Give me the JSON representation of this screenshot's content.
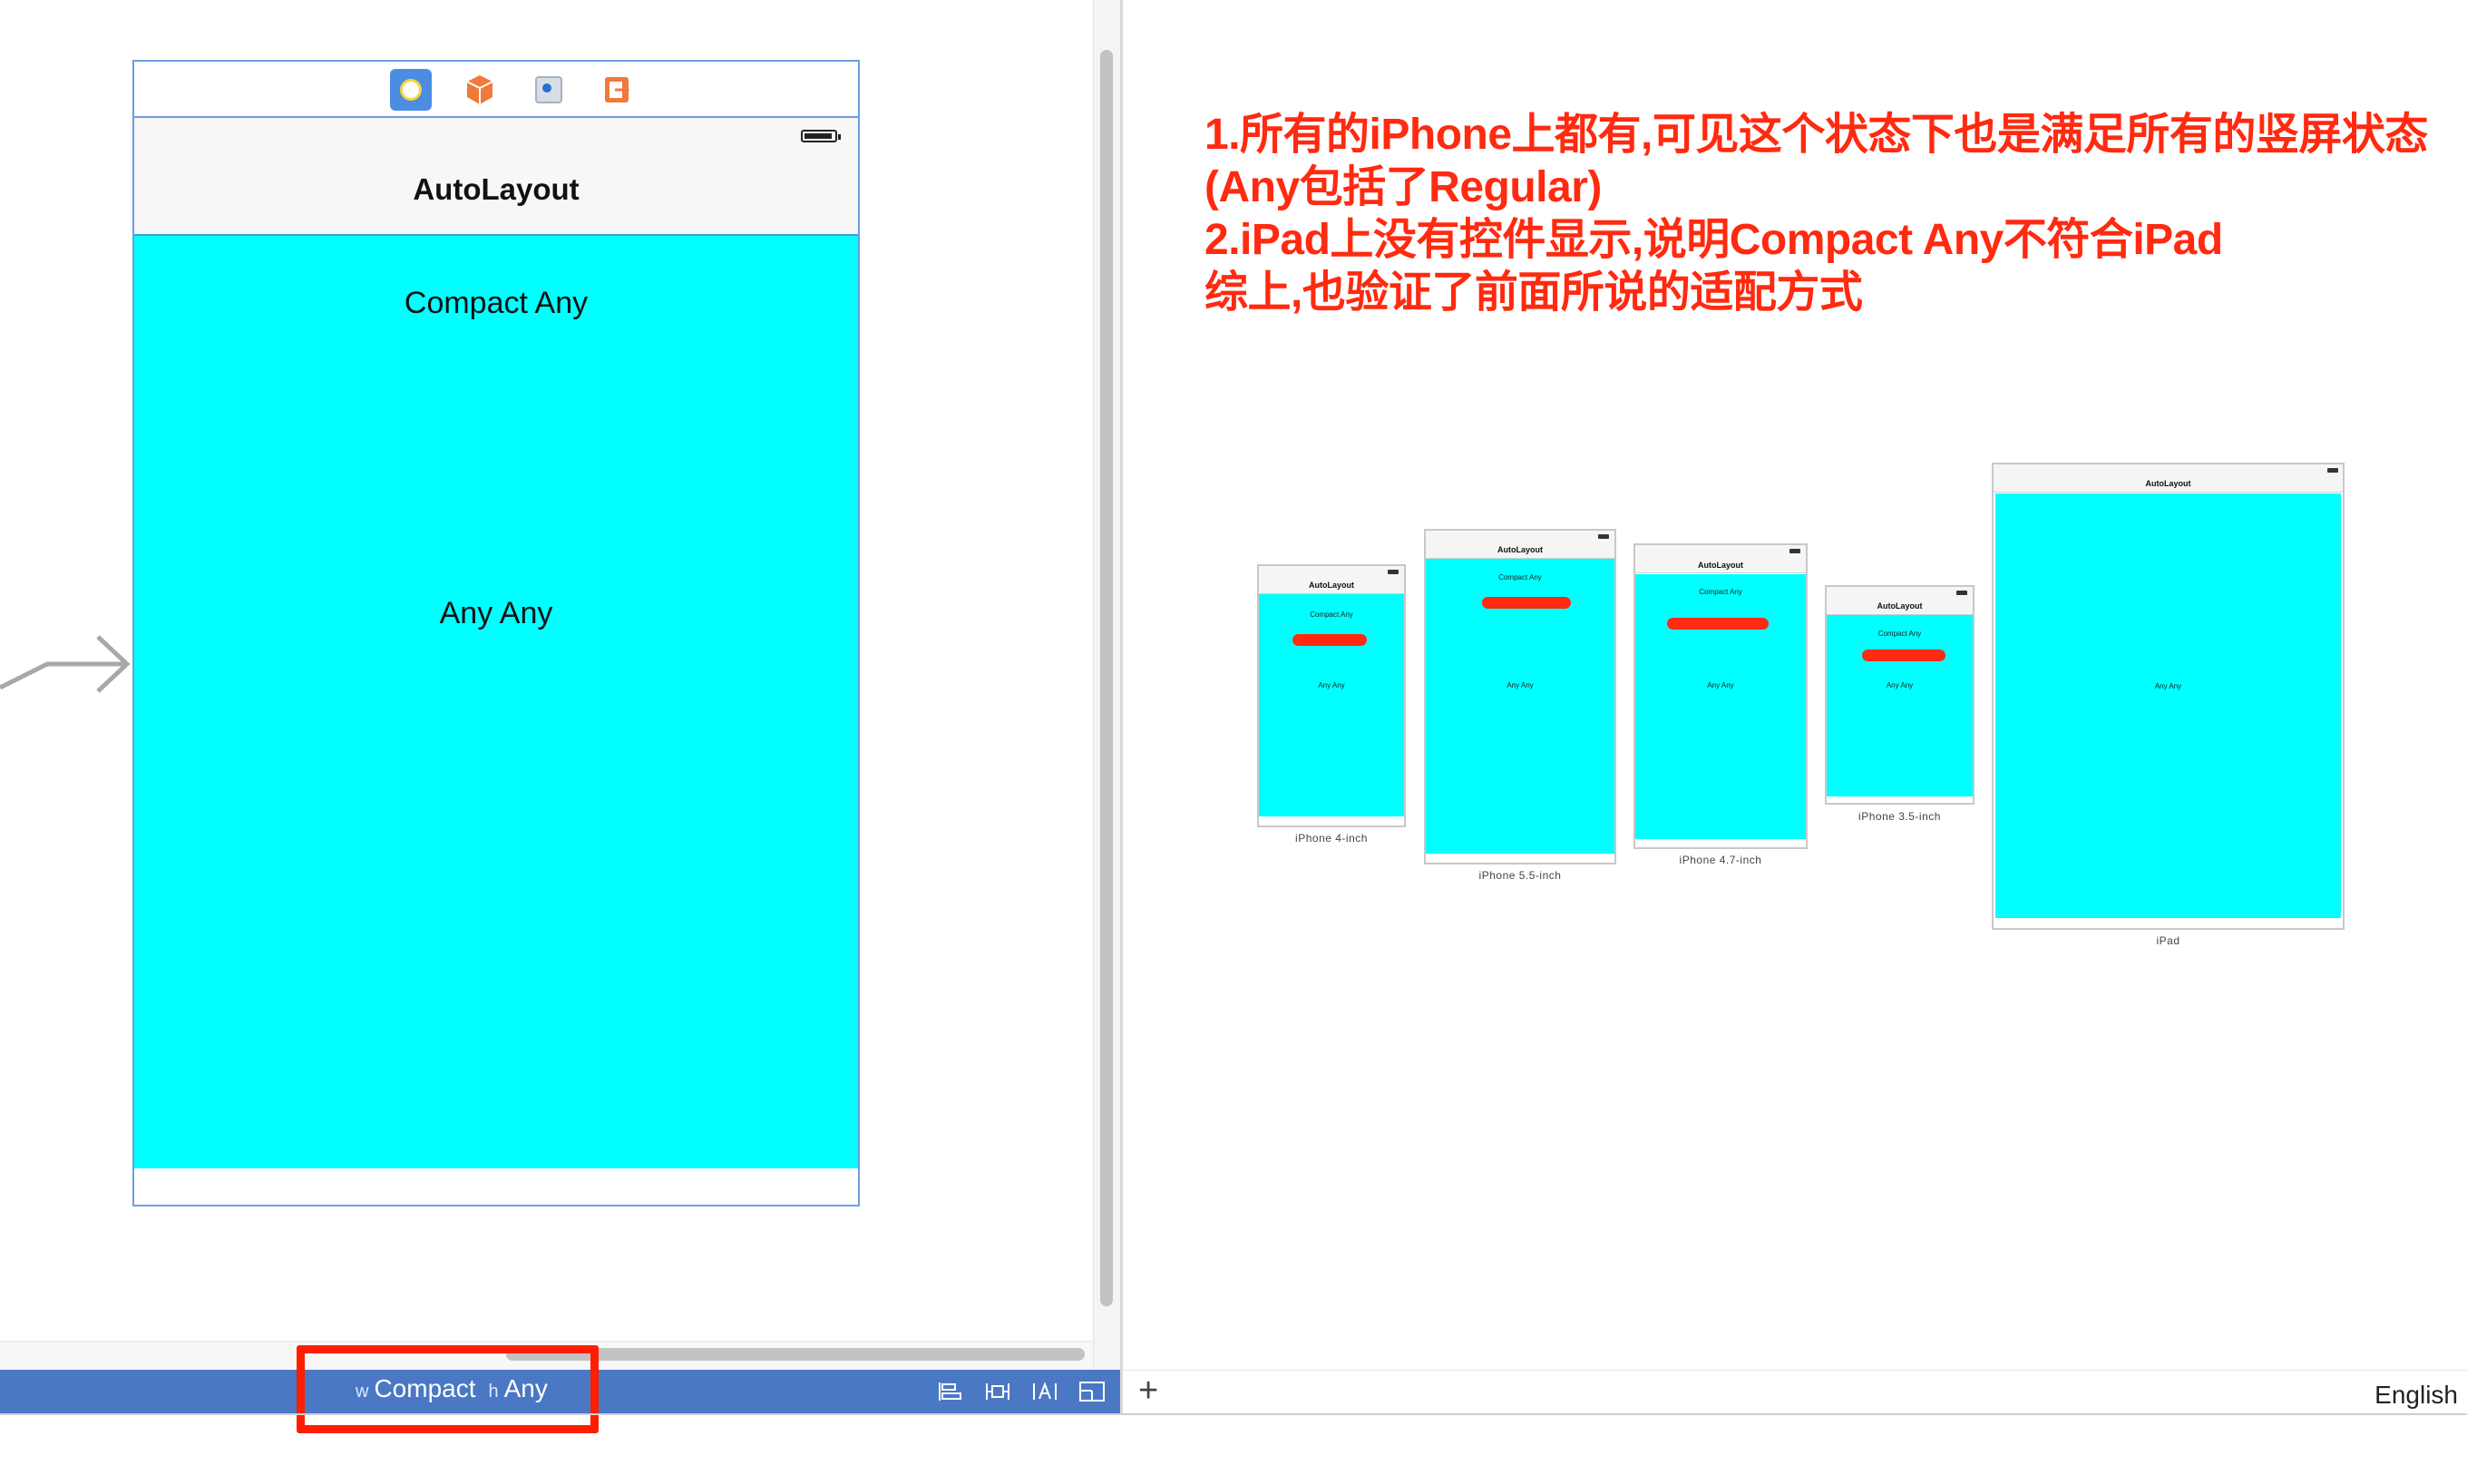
{
  "scene": {
    "nav_title": "AutoLayout",
    "label_compact": "Compact Any",
    "label_anyany": "Any Any",
    "dock_icons": [
      "view-controller-icon",
      "first-responder-icon",
      "object-icon",
      "exit-icon"
    ]
  },
  "size_class": {
    "w_prefix": "w",
    "width_value": "Compact",
    "h_prefix": "h",
    "height_value": "Any"
  },
  "toolbar": {
    "icons": [
      "align-icon",
      "pin-icon",
      "resolve-issues-icon",
      "resizing-icon"
    ],
    "add_button": "+",
    "language": "English"
  },
  "annotation": {
    "line1": "1.所有的iPhone上都有,可见这个状态下也是满足所有的竖屏状态",
    "line2": "(Any包括了Regular)",
    "line3": "2.iPad上没有控件显示,说明Compact Any不符合iPad",
    "line4": "综上,也验证了前面所说的适配方式"
  },
  "preview": {
    "devices": [
      {
        "name": "iPhone 4-inch",
        "title": "AutoLayout",
        "compact": "Compact Any",
        "anyany": "Any Any"
      },
      {
        "name": "iPhone 5.5-inch",
        "title": "AutoLayout",
        "compact": "Compact Any",
        "anyany": "Any Any"
      },
      {
        "name": "iPhone 4.7-inch",
        "title": "AutoLayout",
        "compact": "Compact Any",
        "anyany": "Any Any"
      },
      {
        "name": "iPhone 3.5-inch",
        "title": "AutoLayout",
        "compact": "Compact Any",
        "anyany": "Any Any"
      },
      {
        "name": "iPad",
        "title": "AutoLayout",
        "anyany": "Any Any"
      }
    ]
  },
  "colors": {
    "cyan": "#00ffff",
    "size_bar": "#4a78c4",
    "annotation_red": "#ff2a10",
    "scene_border": "#6d9ee0"
  }
}
